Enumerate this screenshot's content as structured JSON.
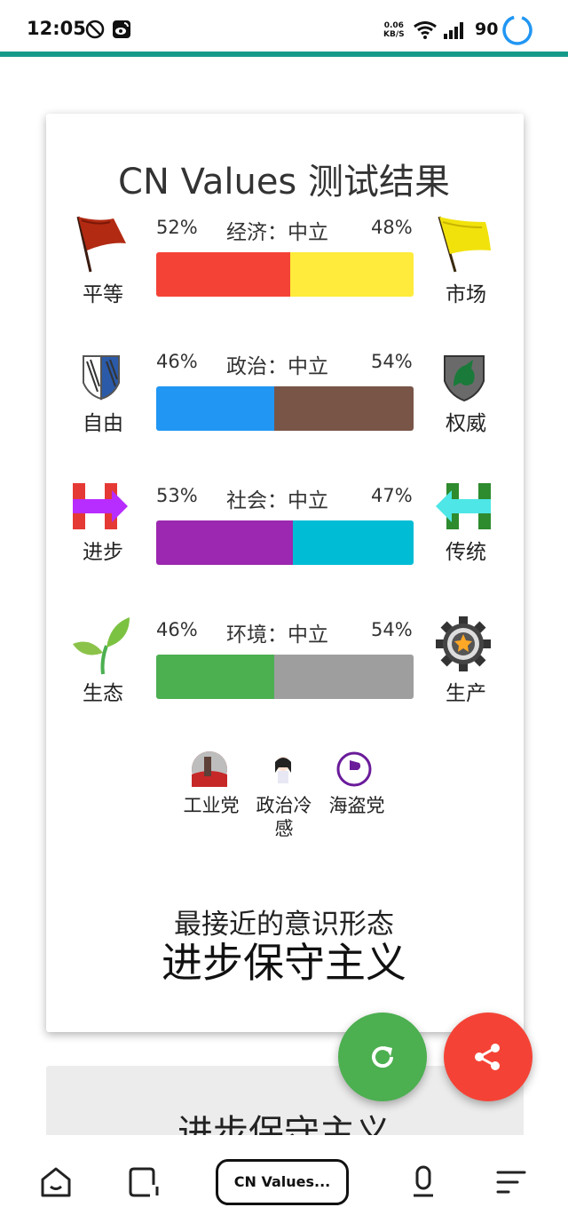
{
  "status": {
    "time": "12:05",
    "net_speed_value": "0.06",
    "net_speed_unit": "KB/S",
    "battery": "90"
  },
  "title": "CN Values 测试结果",
  "axes": [
    {
      "left_label": "平等",
      "right_label": "市场",
      "left_pct": "52%",
      "right_pct": "48%",
      "title": "经济：中立",
      "left_value": 52,
      "right_value": 48,
      "left_color": "#f44336",
      "right_color": "#ffeb3b"
    },
    {
      "left_label": "自由",
      "right_label": "权威",
      "left_pct": "46%",
      "right_pct": "54%",
      "title": "政治：中立",
      "left_value": 46,
      "right_value": 54,
      "left_color": "#2196f3",
      "right_color": "#795548"
    },
    {
      "left_label": "进步",
      "right_label": "传统",
      "left_pct": "53%",
      "right_pct": "47%",
      "title": "社会：中立",
      "left_value": 53,
      "right_value": 47,
      "left_color": "#9c27b0",
      "right_color": "#00bcd4"
    },
    {
      "left_label": "生态",
      "right_label": "生产",
      "left_pct": "46%",
      "right_pct": "54%",
      "title": "环境：中立",
      "left_value": 46,
      "right_value": 54,
      "left_color": "#4caf50",
      "right_color": "#9e9e9e"
    }
  ],
  "parties": [
    "工业党",
    "政治冷感",
    "海盗党"
  ],
  "ideology_label": "最接近的意识形态",
  "ideology": "进步保守主义",
  "card2_title": "进步保守主义",
  "nav": {
    "tab_label": "CN Values..."
  },
  "fab": {
    "refresh_color": "#4caf50",
    "share_color": "#f44336"
  }
}
